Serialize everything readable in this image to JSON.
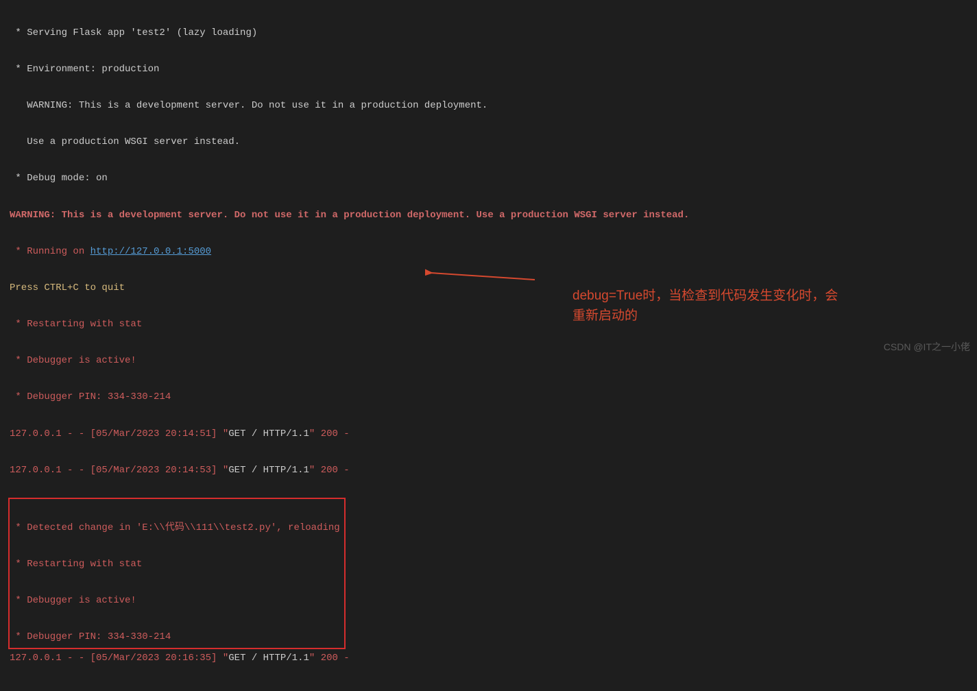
{
  "lines": {
    "l1": " * Serving Flask app 'test2' (lazy loading)",
    "l2": " * Environment: production",
    "l3": "   WARNING: This is a development server. Do not use it in a production deployment.",
    "l4": "   Use a production WSGI server instead.",
    "l5": " * Debug mode: on",
    "l6": "WARNING: This is a development server. Do not use it in a production deployment. Use a production WSGI server instead.",
    "l7a": " * Running on ",
    "l7b": "http://127.0.0.1:5000",
    "l8": "Press CTRL+C to quit",
    "l9": " * Restarting with stat",
    "l10": " * Debugger is active!",
    "l11": " * Debugger PIN: 334-330-214",
    "l12a": "127.0.0.1 - - [05/Mar/2023 20:14:51] \"",
    "l12b": "GET / HTTP/1.1",
    "l12c": "\" 200 -",
    "l13a": "127.0.0.1 - - [05/Mar/2023 20:14:53] \"",
    "l13b": "GET / HTTP/1.1",
    "l13c": "\" 200 -",
    "l14": " * Detected change in 'E:\\\\代码\\\\111\\\\test2.py', reloading",
    "l15": " * Restarting with stat",
    "l16": " * Debugger is active!",
    "l17": " * Debugger PIN: 334-330-214",
    "l18a": "127.0.0.1 - - [05/Mar/2023 20:16:35] \"",
    "l18b": "GET / HTTP/1.1",
    "l18c": "\" 200 -"
  },
  "annotation": {
    "text1": "debug=True时，当检查到代码发生变化时，会",
    "text2": "重新启动的"
  },
  "watermark": "CSDN @IT之一小佬"
}
